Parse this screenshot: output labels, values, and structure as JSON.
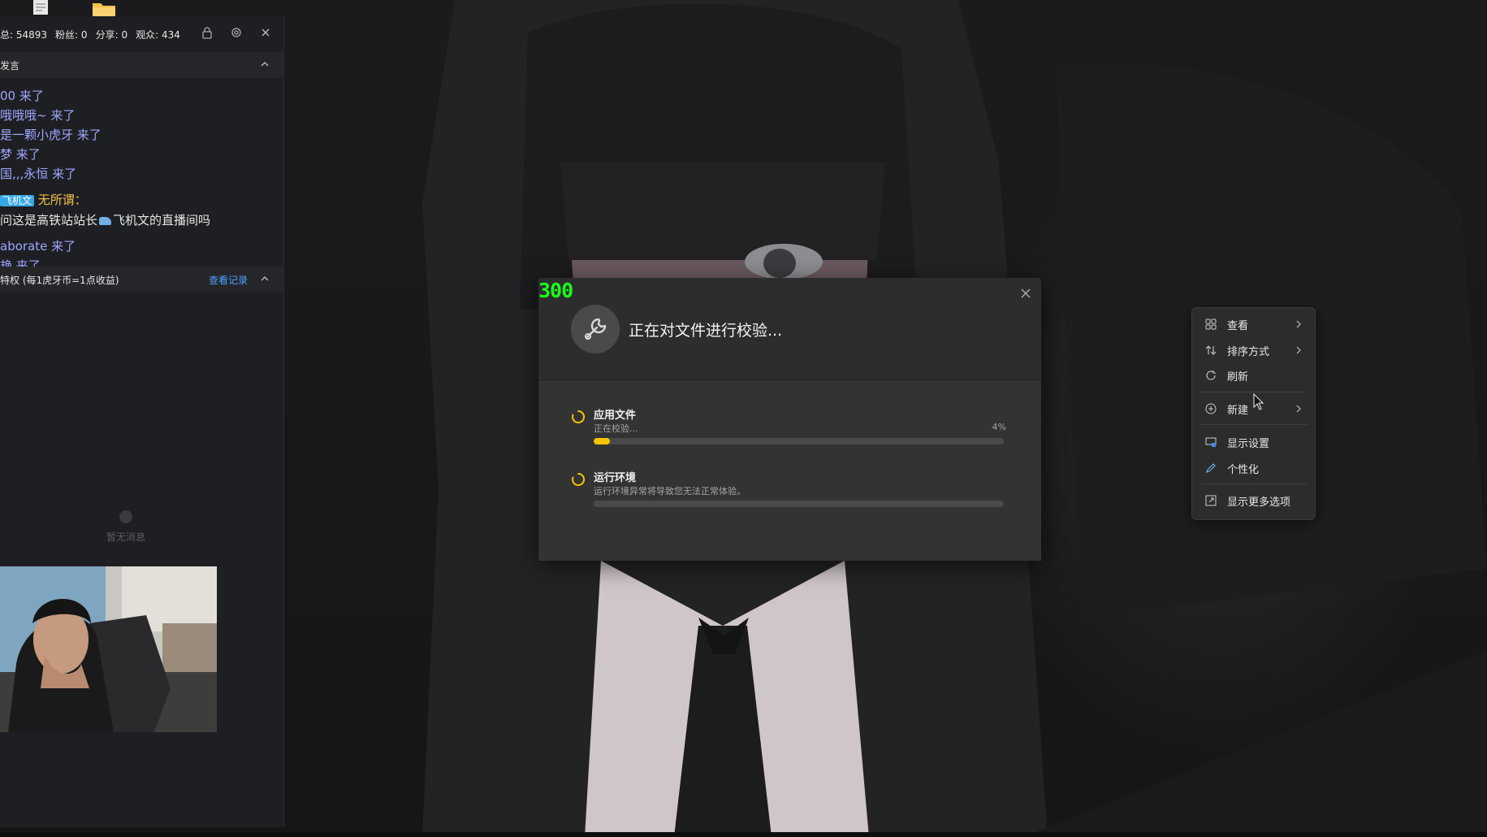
{
  "desktop": {
    "icons": [
      {
        "icon": "document-icon"
      },
      {
        "icon": "folder-icon"
      }
    ]
  },
  "stream_panel": {
    "stats": {
      "views": "总: 54893",
      "fans_label": "粉丝:",
      "fans_value": "0",
      "shares_label": "分享:",
      "shares_value": "0",
      "audience_label": "观众:",
      "audience_value": "434"
    },
    "chat_section_title": "发言",
    "messages": [
      {
        "text": "00 来了"
      },
      {
        "text": "哦哦哦~ 来了"
      },
      {
        "text": "是一颗小虎牙 来了"
      },
      {
        "text": "梦 来了"
      },
      {
        "text": "国,,,永恒 来了"
      }
    ],
    "featured_message": {
      "badge": "飞机文",
      "user": "无所谓：",
      "text_before": "问这是高铁站站长",
      "text_after": "飞机文的直播间吗"
    },
    "after_messages": [
      {
        "text": "aborate 来了"
      },
      {
        "text": "艳 来了"
      }
    ],
    "privilege_section_title": "特权 (每1虎牙币=1点收益)",
    "view_records_link": "查看记录",
    "empty_text": "暂无消息"
  },
  "dialog": {
    "fps_overlay": "300",
    "title": "正在对文件进行校验...",
    "tasks": [
      {
        "name": "应用文件",
        "status": "正在校验...",
        "percent_label": "4%",
        "progress": 0.04
      },
      {
        "name": "运行环境",
        "status": "运行环境异常将导致您无法正常体验。",
        "percent_label": "",
        "progress": 0
      }
    ]
  },
  "context_menu": {
    "items": [
      {
        "label": "查看",
        "icon": "grid-view-icon",
        "submenu": true
      },
      {
        "label": "排序方式",
        "icon": "sort-icon",
        "submenu": true
      },
      {
        "label": "刷新",
        "icon": "refresh-icon",
        "submenu": false
      },
      {
        "label": "新建",
        "icon": "new-plus-icon",
        "submenu": true
      },
      {
        "label": "显示设置",
        "icon": "display-settings-icon",
        "submenu": false
      },
      {
        "label": "个性化",
        "icon": "pen-icon",
        "submenu": false
      },
      {
        "label": "显示更多选项",
        "icon": "more-options-icon",
        "submenu": false
      }
    ]
  },
  "colors": {
    "progress_fill": "#f5c400",
    "fps_green": "#1aff1a",
    "link_blue": "#4aa3ff",
    "chat_purple": "#9ea6ff",
    "username_gold": "#f0c24b"
  }
}
